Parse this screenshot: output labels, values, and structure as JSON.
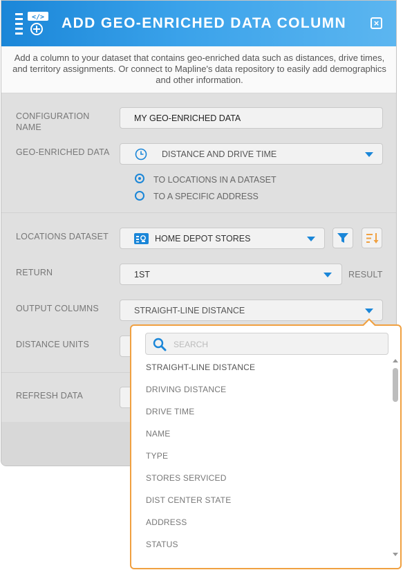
{
  "header": {
    "title": "ADD GEO-ENRICHED DATA COLUMN",
    "icon": "add-data-column-icon",
    "close_icon": "close-icon",
    "colors": {
      "gradient_start": "#1a86d8",
      "gradient_end": "#5cb6f0"
    }
  },
  "intro": {
    "text": "Add a column to your dataset that contains geo-enriched data such as distances, drive times, and territory assignments. Or connect to Mapline's data repository to easily add demographics and other information."
  },
  "form": {
    "configuration_name": {
      "label": "CONFIGURATION NAME",
      "value": "MY GEO-ENRICHED DATA"
    },
    "geo_enriched_data": {
      "label": "GEO-ENRICHED DATA",
      "value": "DISTANCE AND DRIVE TIME",
      "icon": "clock-icon",
      "options": [
        {
          "label": "TO LOCATIONS IN A DATASET",
          "selected": true
        },
        {
          "label": "TO A SPECIFIC ADDRESS",
          "selected": false
        }
      ]
    },
    "locations_dataset": {
      "label": "LOCATIONS DATASET",
      "value": "HOME DEPOT STORES",
      "icon": "dataset-icon",
      "filter_icon": "filter-icon",
      "sort_icon": "sort-icon"
    },
    "return": {
      "label": "RETURN",
      "value": "1ST",
      "suffix": "RESULT"
    },
    "output_columns": {
      "label": "OUTPUT COLUMNS",
      "value": "STRAIGHT-LINE DISTANCE"
    },
    "distance_units": {
      "label": "DISTANCE UNITS"
    },
    "refresh_data": {
      "label": "REFRESH DATA"
    }
  },
  "dropdown": {
    "search_placeholder": "SEARCH",
    "search_icon": "search-icon",
    "options": [
      "STRAIGHT-LINE DISTANCE",
      "DRIVING DISTANCE",
      "DRIVE TIME",
      "NAME",
      "TYPE",
      "STORES SERVICED",
      "DIST CENTER STATE",
      "ADDRESS",
      "STATUS"
    ],
    "accent_color": "#f0a040"
  },
  "colors": {
    "accent_blue": "#1a86d8",
    "panel_bg": "#e0e0e0"
  }
}
